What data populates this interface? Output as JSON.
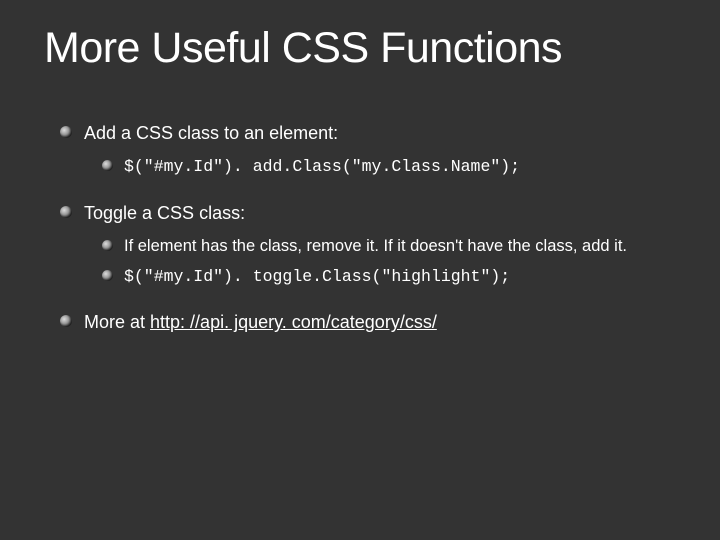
{
  "title": "More Useful CSS Functions",
  "items": [
    {
      "label": "Add a CSS class to an element:",
      "sub": [
        {
          "code": "$(\"#my.Id\"). add.Class(\"my.Class.Name\");"
        }
      ]
    },
    {
      "label": "Toggle a CSS class:",
      "sub": [
        {
          "text": "If element has the class, remove it. If it doesn't have the class, add it."
        },
        {
          "code": "$(\"#my.Id\"). toggle.Class(\"highlight\");"
        }
      ]
    },
    {
      "label_prefix": "More at ",
      "link": "http: //api. jquery. com/category/css/"
    }
  ]
}
